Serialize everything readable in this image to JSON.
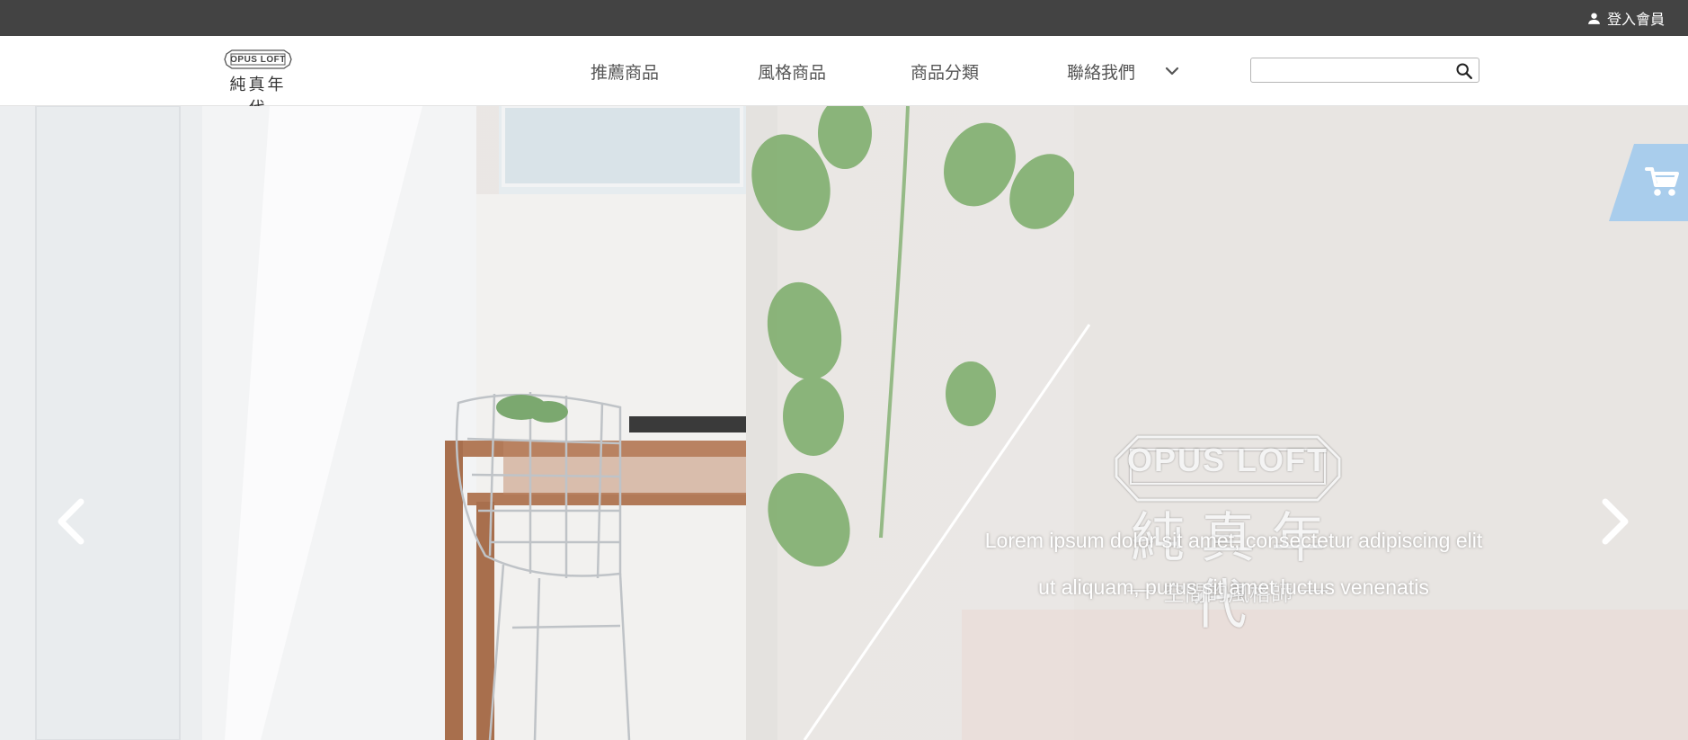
{
  "topbar": {
    "member_label": "登入會員",
    "member_icon": "person-icon",
    "background": "#434343"
  },
  "brand": {
    "badge_text": "OPUS LOFT",
    "name_cn": "純真年代"
  },
  "nav": {
    "items": [
      {
        "label": "推薦商品"
      },
      {
        "label": "風格商品"
      },
      {
        "label": "商品分類"
      },
      {
        "label": "聯絡我們"
      }
    ],
    "chevron_icon": "chevron-down-icon"
  },
  "search": {
    "value": "",
    "placeholder": "",
    "icon": "search-icon"
  },
  "hero": {
    "badge_text": "OPUS LOFT",
    "title_cn": "純真年代",
    "subtitle_cn": "空間的風格師",
    "caption_line1": "Lorem ipsum dolor sit amet, consectetur adipiscing elit",
    "caption_line2": "ut aliquam, purus sit amet luctus venenatis",
    "prev_icon": "chevron-left-icon",
    "next_icon": "chevron-right-icon"
  },
  "cart": {
    "icon": "cart-icon",
    "color": "#a9cdec"
  }
}
